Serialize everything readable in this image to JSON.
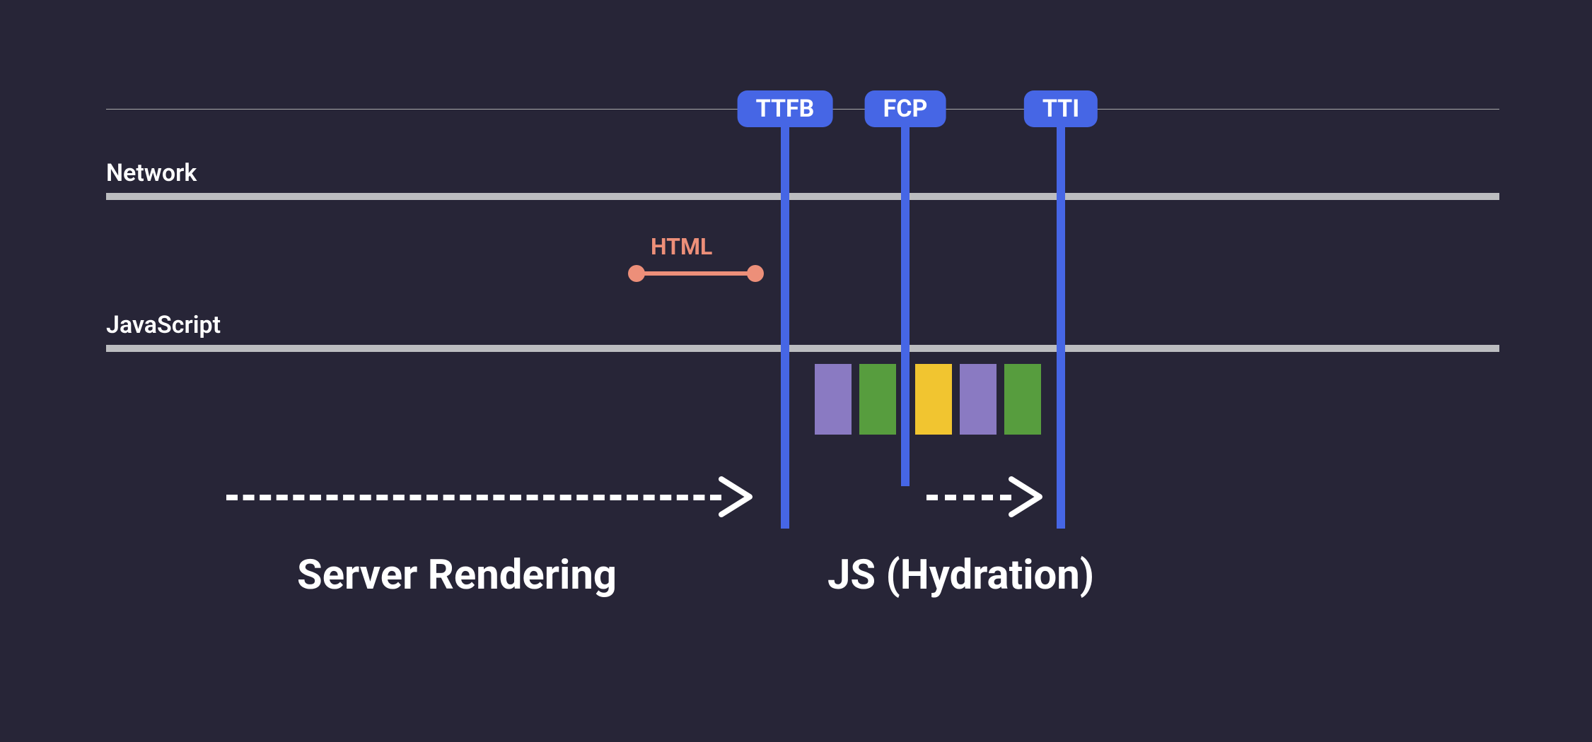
{
  "lanes": {
    "network": "Network",
    "javascript": "JavaScript"
  },
  "badges": {
    "ttfb": "TTFB",
    "fcp": "FCP",
    "tti": "TTI"
  },
  "html_label": "HTML",
  "phases": {
    "server": "Server Rendering",
    "js": "JS (Hydration)"
  },
  "tasks": [
    {
      "color": "#8a7ac2"
    },
    {
      "color": "#579d3e"
    },
    {
      "color": "#f1c530"
    },
    {
      "color": "#8a7ac2"
    },
    {
      "color": "#579d3e"
    }
  ]
}
